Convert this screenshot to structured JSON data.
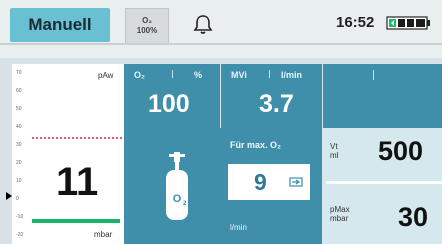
{
  "header": {
    "mode_label": "Manuell",
    "o2_badge_line1": "O₂",
    "o2_badge_line2": "100%",
    "time": "16:52"
  },
  "waveform": {
    "paw_label": "pAw",
    "value": "11",
    "unit_label": "mbar",
    "scale_ticks": [
      "70",
      "60",
      "50",
      "40",
      "30",
      "20",
      "10",
      "0",
      "-10",
      "-20"
    ]
  },
  "tiles": {
    "o2": {
      "label": "O₂",
      "unit": "%",
      "value": "100"
    },
    "mv": {
      "label": "MVi",
      "unit": "l/min",
      "value": "3.7"
    }
  },
  "o2_control": {
    "label": "Für max. O₂",
    "value": "9",
    "unit": "l/min"
  },
  "right_column": {
    "vt_label_line1": "Vt",
    "vt_label_line2": "ml",
    "vt_value": "500",
    "pmax_label_line1": "pMax",
    "pmax_label_line2": "mbar",
    "pmax_value": "30"
  },
  "colors": {
    "accent": "#69c0d3",
    "tile": "#3f8eaa",
    "alarm_line": "#e05a73",
    "green_line": "#19b36a",
    "battery": "#1db86a"
  },
  "icons": {
    "bell": "bell-icon",
    "battery": "battery-icon",
    "cylinder": "oxygen-cylinder-icon",
    "flow": "flow-icon"
  }
}
